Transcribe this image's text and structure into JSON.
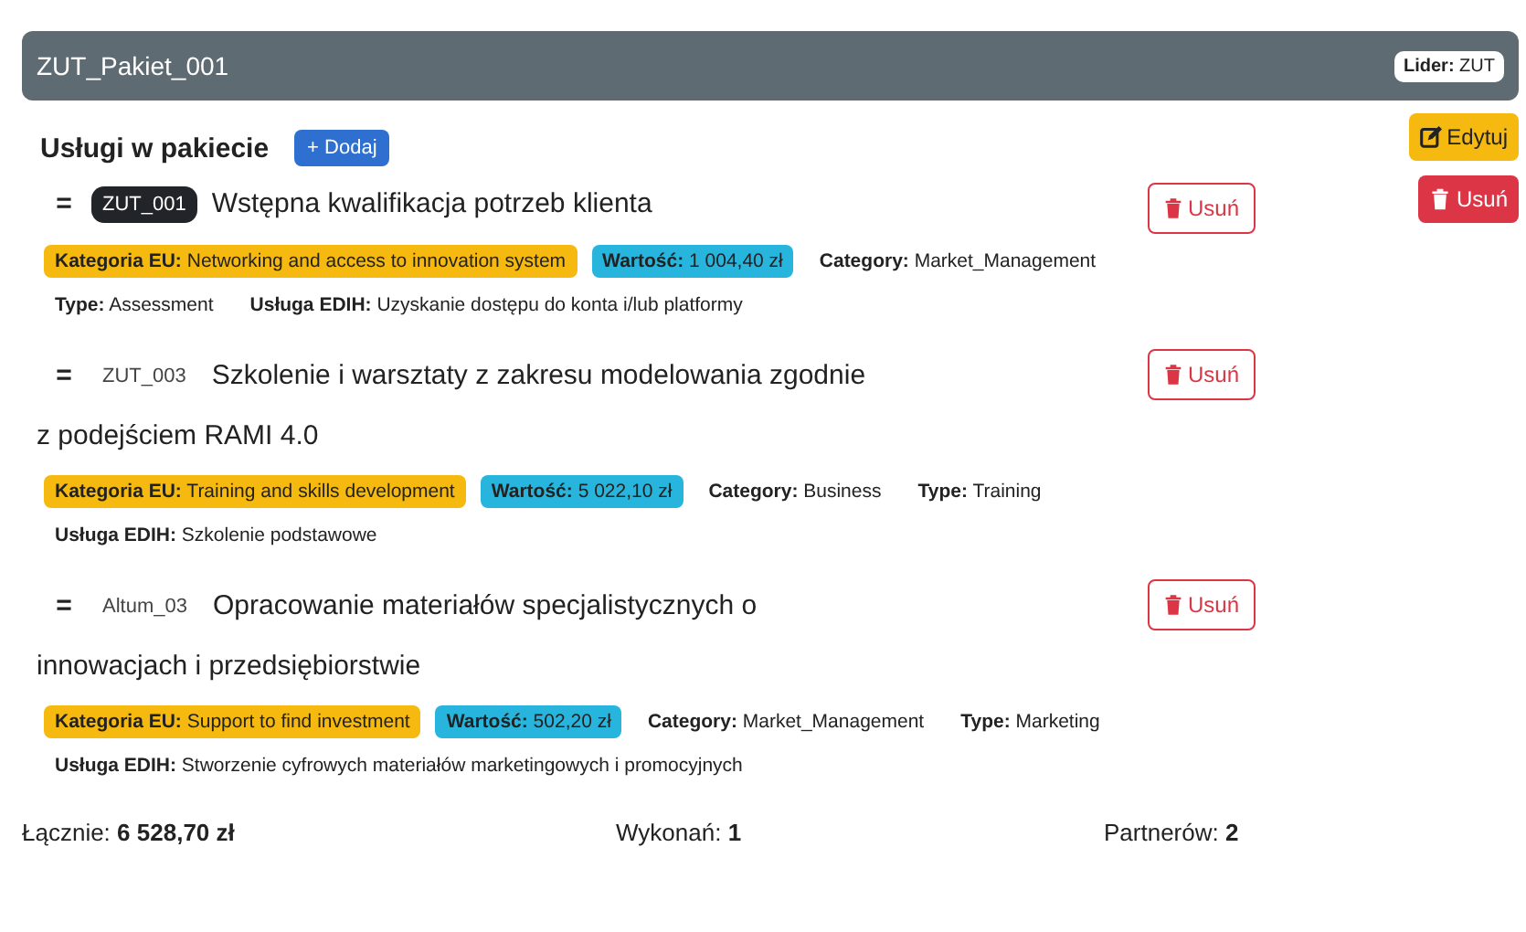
{
  "header": {
    "title": "ZUT_Pakiet_001",
    "leader": "**Lider:** ZUT"
  },
  "section": {
    "title": "Usługi w pakiecie",
    "add_button": "+ Dodaj"
  },
  "actions": [
    {
      "kind": "edit",
      "label": "Edytuj"
    },
    {
      "kind": "delete",
      "label": "Usuń"
    }
  ],
  "services": [
    {
      "handle": "=",
      "code": "ZUT_001",
      "highlighted": true,
      "title": [
        "Wstępna kwalifikacja potrzeb klienta"
      ],
      "remove": "Usuń",
      "tags": [
        {
          "kind": "eu",
          "text": "**Kategoria EU:** Networking and access to innovation system"
        },
        {
          "kind": "value",
          "text": "**Wartość:** 1 004,40 zł"
        },
        {
          "kind": "plain",
          "text": "**Category:** Market_Management"
        },
        {
          "kind": "plain",
          "text": "**Type:** Assessment"
        },
        {
          "kind": "plain",
          "text": "**Usługa EDIH:** Uzyskanie dostępu do konta i/lub platformy"
        }
      ]
    },
    {
      "handle": "=",
      "code": "ZUT_003",
      "highlighted": false,
      "title": [
        "Szkolenie i warsztaty z zakresu modelowania zgodnie",
        "z podejściem RAMI 4.0"
      ],
      "remove": "Usuń",
      "tags": [
        {
          "kind": "eu",
          "text": "**Kategoria EU:** Training and skills development"
        },
        {
          "kind": "value",
          "text": "**Wartość:** 5 022,10 zł"
        },
        {
          "kind": "plain",
          "text": "**Category:** Business"
        },
        {
          "kind": "plain",
          "text": "**Type:** Training"
        },
        {
          "kind": "plain",
          "text": "**Usługa EDIH:** Szkolenie podstawowe"
        }
      ]
    },
    {
      "handle": "=",
      "code": "Altum_03",
      "highlighted": false,
      "title": [
        "Opracowanie materiałów specjalistycznych o",
        "innowacjach i przedsiębiorstwie"
      ],
      "remove": "Usuń",
      "tags": [
        {
          "kind": "eu",
          "text": "**Kategoria EU:** Support to find investment"
        },
        {
          "kind": "value",
          "text": "**Wartość:** 502,20 zł"
        },
        {
          "kind": "plain",
          "text": "**Category:** Market_Management"
        },
        {
          "kind": "plain",
          "text": "**Type:** Marketing"
        },
        {
          "kind": "plain",
          "text": "**Usługa EDIH:** Stworzenie cyfrowych materiałów marketingowych i promocyjnych"
        }
      ]
    }
  ],
  "footer": [
    {
      "text": "Łącznie: **6 528,70 zł**"
    },
    {
      "text": "Wykonań: **1**"
    },
    {
      "text": "Partnerów: **2**"
    }
  ]
}
